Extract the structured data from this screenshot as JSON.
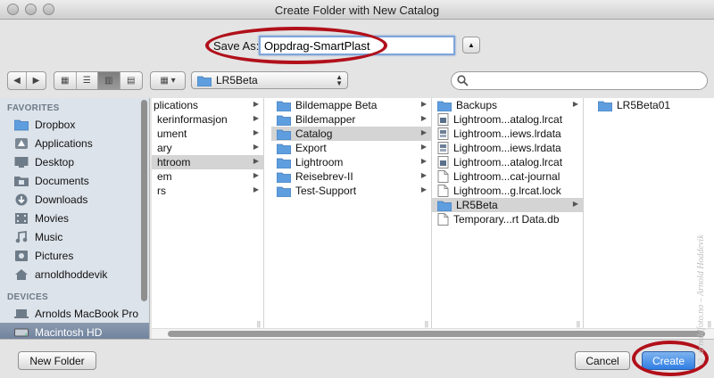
{
  "window": {
    "title": "Create Folder with New Catalog"
  },
  "save_as": {
    "label": "Save As:",
    "value": "Oppdrag-SmartPlast"
  },
  "toolbar": {
    "path": "LR5Beta",
    "search_placeholder": ""
  },
  "sidebar": {
    "favorites_header": "FAVORITES",
    "favorites": [
      {
        "label": "Dropbox",
        "icon": "folder-icon"
      },
      {
        "label": "Applications",
        "icon": "applications-icon"
      },
      {
        "label": "Desktop",
        "icon": "desktop-icon"
      },
      {
        "label": "Documents",
        "icon": "documents-icon"
      },
      {
        "label": "Downloads",
        "icon": "downloads-icon"
      },
      {
        "label": "Movies",
        "icon": "movies-icon"
      },
      {
        "label": "Music",
        "icon": "music-icon"
      },
      {
        "label": "Pictures",
        "icon": "pictures-icon"
      },
      {
        "label": "arnoldhoddevik",
        "icon": "home-icon"
      }
    ],
    "devices_header": "DEVICES",
    "devices": [
      {
        "label": "Arnolds MacBook Pro",
        "icon": "laptop-icon"
      },
      {
        "label": "Macintosh HD",
        "icon": "harddisk-icon",
        "selected": true
      }
    ]
  },
  "columns": {
    "col1": [
      {
        "label": "plications",
        "selected": false
      },
      {
        "label": "kerinformasjon",
        "selected": false
      },
      {
        "label": "ument",
        "selected": false
      },
      {
        "label": "ary",
        "selected": false
      },
      {
        "label": "htroom",
        "selected": true
      },
      {
        "label": "em",
        "selected": false
      },
      {
        "label": "rs",
        "selected": false
      }
    ],
    "col2": [
      {
        "label": "Bildemappe Beta",
        "selected": false
      },
      {
        "label": "Bildemapper",
        "selected": false
      },
      {
        "label": "Catalog",
        "selected": true
      },
      {
        "label": "Export",
        "selected": false
      },
      {
        "label": "Lightroom",
        "selected": false
      },
      {
        "label": "Reisebrev-II",
        "selected": false
      },
      {
        "label": "Test-Support",
        "selected": false
      }
    ],
    "col3": [
      {
        "label": "Backups",
        "kind": "folder",
        "selected": false
      },
      {
        "label": "Lightroom...atalog.lrcat",
        "kind": "lrcat",
        "selected": false
      },
      {
        "label": "Lightroom...iews.lrdata",
        "kind": "lrdata",
        "selected": false
      },
      {
        "label": "Lightroom...iews.lrdata",
        "kind": "lrdata",
        "selected": false
      },
      {
        "label": "Lightroom...atalog.lrcat",
        "kind": "lrcat",
        "selected": false
      },
      {
        "label": "Lightroom...cat-journal",
        "kind": "doc",
        "selected": false
      },
      {
        "label": "Lightroom...g.lrcat.lock",
        "kind": "doc",
        "selected": false
      },
      {
        "label": "LR5Beta",
        "kind": "folder",
        "selected": true
      },
      {
        "label": "Temporary...rt Data.db",
        "kind": "doc",
        "selected": false
      }
    ],
    "col4": [
      {
        "label": "LR5Beta01",
        "kind": "folder",
        "selected": false
      }
    ]
  },
  "buttons": {
    "new_folder": "New Folder",
    "cancel": "Cancel",
    "create": "Create"
  },
  "watermark": "© arnoldfoto.no – Arnold Hoddevik",
  "colors": {
    "accent": "#2f7ee4",
    "highlight_ring": "#b1101a",
    "folder": "#5f9ede"
  }
}
